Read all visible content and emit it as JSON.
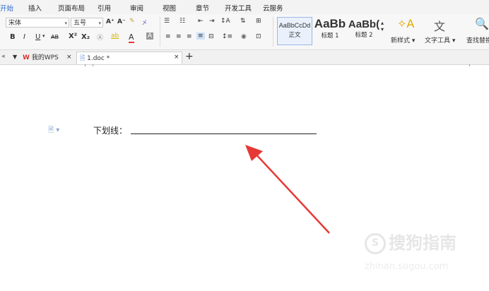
{
  "menubar": {
    "tabs": [
      "开始",
      "插入",
      "页面布局",
      "引用",
      "审阅",
      "视图",
      "章节",
      "开发工具",
      "云服务"
    ]
  },
  "ribbon": {
    "font_name": "宋体",
    "font_size": "五号",
    "grow_font": "A⁺",
    "shrink_font": "A⁻",
    "bold": "B",
    "italic": "I",
    "underline": "U",
    "strike": "AB",
    "superscript": "X²",
    "subscript": "X₂",
    "font_color": "A",
    "styles": [
      {
        "preview": "AaBbCcDd",
        "name": "正文"
      },
      {
        "preview": "AaBb",
        "name": "标题 1"
      },
      {
        "preview": "AaBb(",
        "name": "标题 2"
      }
    ],
    "new_style": "新样式",
    "text_tools": "文字工具",
    "find_replace": "查找替换"
  },
  "tabbar": {
    "wps_tab": "我的WPS",
    "doc_tab": "1.doc *",
    "new_tab": "+"
  },
  "document": {
    "line_label": "下划线："
  },
  "watermark": {
    "brand": "搜狗指南",
    "url": "zhinan.sogou.com"
  },
  "colors": {
    "accent": "#2c6bd0",
    "arrow": "#e53935",
    "wps_red": "#d9342b"
  }
}
